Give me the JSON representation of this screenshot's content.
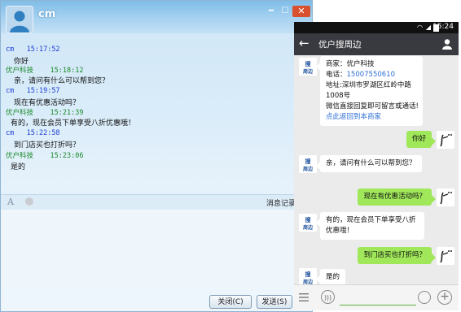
{
  "desktop": {
    "contact_name": "cm",
    "messages": [
      {
        "sender": "cm",
        "time": "15:17:52",
        "text": "你好"
      },
      {
        "sender": "优户科技",
        "time": "15:18:12",
        "text": "亲，请问有什么可以帮到您？"
      },
      {
        "sender": "cm",
        "time": "15:19:57",
        "text": "现在有优惠活动吗？"
      },
      {
        "sender": "优户科技",
        "time": "15:21:39",
        "text": "有的，现在会员下单享受八折优惠哦！"
      },
      {
        "sender": "cm",
        "time": "15:22:58",
        "text": "到门店买也打折吗？"
      },
      {
        "sender": "优户科技",
        "time": "15:23:06",
        "text": "是的"
      }
    ],
    "history_label": "消息记录",
    "close_button": "关闭(C)",
    "send_button": "发送(S)",
    "colors": {
      "self_meta": "#1f3fd6",
      "business_meta": "#1a8a2a"
    }
  },
  "mobile": {
    "status_time": "15:24",
    "chat_title": "优户搜周边",
    "business_card": {
      "merchant": "商家：优户科技",
      "phone_label": "电话：",
      "phone": "15007550610",
      "address_line1": "地址:深圳市罗湖区红岭中路",
      "address_line2": "1008号",
      "note": "微信直接回复即可留言或通话!",
      "link": "点此返回到本商家"
    },
    "messages": [
      {
        "from": "user",
        "text": "你好"
      },
      {
        "from": "business",
        "text": "亲，请问有什么可以帮到您？"
      },
      {
        "from": "user",
        "text": "现在有优惠活动吗？"
      },
      {
        "from": "business",
        "text_line1": "有的，现在会员下单享受八折",
        "text_line2": "优惠哦！"
      },
      {
        "from": "user",
        "text": "到门店买也打折吗？"
      },
      {
        "from": "business",
        "text": "是的"
      }
    ],
    "colors": {
      "header": "#393a3f",
      "user_bubble": "#a0e75a",
      "link": "#2f6fd6"
    }
  }
}
